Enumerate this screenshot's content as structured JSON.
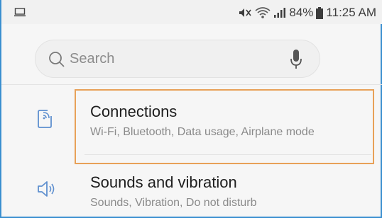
{
  "status_bar": {
    "battery_percent": "84%",
    "time": "11:25 AM",
    "left_icon": "screen-mirror-icon",
    "icons": [
      "mute-icon",
      "wifi-icon",
      "signal-icon",
      "battery-icon"
    ]
  },
  "search": {
    "placeholder": "Search",
    "icon": "search-icon",
    "mic_icon": "microphone-icon"
  },
  "settings": [
    {
      "title": "Connections",
      "subtitle": "Wi-Fi, Bluetooth, Data usage, Airplane mode",
      "icon": "connections-icon",
      "highlighted": true
    },
    {
      "title": "Sounds and vibration",
      "subtitle": "Sounds, Vibration, Do not disturb",
      "icon": "volume-icon",
      "highlighted": false
    }
  ],
  "colors": {
    "accent_blue": "#3a8fd0",
    "highlight_orange": "#e8a158",
    "icon_blue": "#5e8fcf"
  }
}
